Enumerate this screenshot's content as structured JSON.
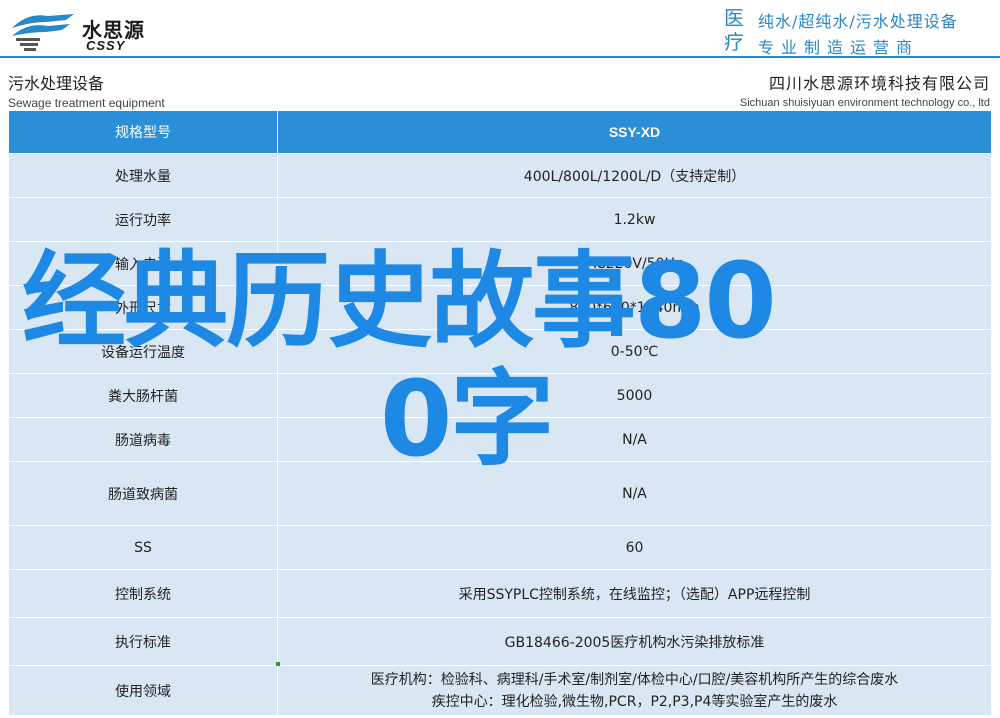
{
  "header": {
    "logo_cn": "水思源",
    "logo_en": "CSSY",
    "slogan_big": "医疗",
    "slogan_line1": "纯水/超纯水/污水处理设备",
    "slogan_line2": "专业制造运营商"
  },
  "subheader": {
    "left_cn": "污水处理设备",
    "left_en": "Sewage treatment equipment",
    "right_cn": "四川水思源环境科技有限公司",
    "right_en": "Sichuan shuisiyuan environment technology co., ltd"
  },
  "table": {
    "header": {
      "label": "规格型号",
      "value": "SSY-XD"
    },
    "rows": [
      {
        "label": "处理水量",
        "value": "400L/800L/1200L/D（支持定制）"
      },
      {
        "label": "运行功率",
        "value": "1.2kw"
      },
      {
        "label": "输入电源",
        "value": "AC220V/50Hz"
      },
      {
        "label": "外形尺寸",
        "value": "830*660*1440mm"
      },
      {
        "label": "设备运行温度",
        "value": "0-50℃"
      },
      {
        "label": "粪大肠杆菌",
        "value": "5000"
      },
      {
        "label": "肠道病毒",
        "value": "N/A"
      },
      {
        "label": "肠道致病菌",
        "value": "N/A"
      },
      {
        "label": "SS",
        "value": "60"
      },
      {
        "label": "控制系统",
        "value": "采用SSYPLC控制系统，在线监控；（选配）APP远程控制"
      },
      {
        "label": "执行标准",
        "value": "GB18466-2005医疗机构水污染排放标准"
      },
      {
        "label": "使用领域",
        "value_line1": "医疗机构：检验科、病理科/手术室/制剂室/体检中心/口腔/美容机构所产生的综合废水",
        "value_line2": "疾控中心：理化检验,微生物,PCR，P2,P3,P4等实验室产生的废水"
      }
    ]
  },
  "overlay": {
    "line1": "经典历史故事80",
    "line2": "0字"
  },
  "colors": {
    "accent": "#2a87c8",
    "table_header": "#2a8fd6",
    "table_row": "#d9e6f4",
    "overlay_text": "#1e88e5"
  }
}
